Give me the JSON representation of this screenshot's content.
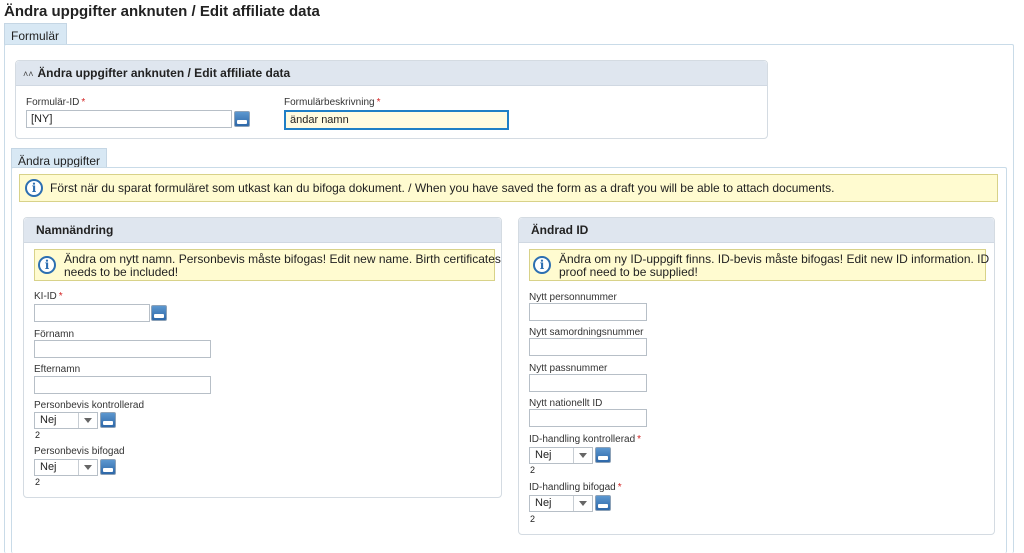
{
  "page_title": "Ändra uppgifter anknuten / Edit affiliate data",
  "tabs": {
    "form_tab": "Formulär",
    "change_tab": "Ändra uppgifter"
  },
  "form_panel": {
    "title": "Ändra uppgifter anknuten / Edit affiliate data",
    "form_id_label": "Formulär-ID",
    "form_id_value": "[NY]",
    "description_label": "Formulärbeskrivning",
    "description_value": "ändar namn"
  },
  "info_banner": "Först när du sparat formuläret som utkast kan du bifoga dokument. / When you have saved the form as a draft you will be able to attach documents.",
  "name_change": {
    "title": "Namnändring",
    "info_line1": "Ändra om nytt namn. Personbevis måste bifogas! Edit new name. Birth certificates",
    "info_line2": "needs to be included!",
    "ki_id_label": "KI-ID",
    "ki_id_value": "",
    "first_name_label": "Förnamn",
    "first_name_value": "",
    "last_name_label": "Efternamn",
    "last_name_value": "",
    "cert_checked_label": "Personbevis kontrollerad",
    "cert_checked_value": "Nej",
    "cert_checked_count": "2",
    "cert_attached_label": "Personbevis bifogad",
    "cert_attached_value": "Nej",
    "cert_attached_count": "2"
  },
  "id_change": {
    "title": "Ändrad ID",
    "info_line1": "Ändra om ny ID-uppgift finns. ID-bevis måste bifogas! Edit new ID information. ID",
    "info_line2": "proof need to be supplied!",
    "personnummer_label": "Nytt personnummer",
    "personnummer_value": "",
    "samordning_label": "Nytt samordningsnummer",
    "samordning_value": "",
    "pass_label": "Nytt passnummer",
    "pass_value": "",
    "national_label": "Nytt nationellt ID",
    "national_value": "",
    "id_checked_label": "ID-handling kontrollerad",
    "id_checked_value": "Nej",
    "id_checked_count": "2",
    "id_attached_label": "ID-handling bifogad",
    "id_attached_value": "Nej",
    "id_attached_count": "2"
  },
  "icons": {
    "info": "info-icon",
    "collapse": "chevron-up-icon",
    "picker": "lookup-icon",
    "dropdown": "chevron-down-icon"
  },
  "colors": {
    "accent": "#1f7fc6",
    "tab_bg": "#d8e8f4",
    "panel_header": "#dfe6ef",
    "info_bg": "#fffbd0",
    "required": "#d32424"
  }
}
